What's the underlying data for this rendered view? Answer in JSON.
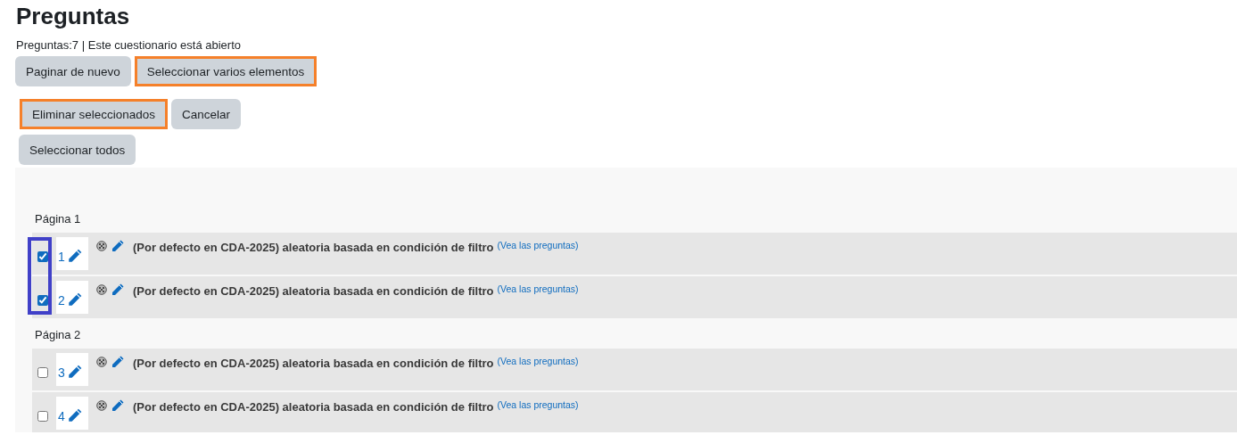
{
  "title": "Preguntas",
  "info": "Preguntas:7 | Este cuestionario está abierto",
  "button_rows": [
    [
      {
        "label": "Paginar de nuevo",
        "highlighted": false
      },
      {
        "label": "Seleccionar varios elementos",
        "highlighted": true
      }
    ],
    [
      {
        "label": "Eliminar seleccionados",
        "highlighted": true
      },
      {
        "label": "Cancelar",
        "highlighted": false
      }
    ],
    [
      {
        "label": "Seleccionar todos",
        "highlighted": false
      }
    ]
  ],
  "pages": [
    {
      "label": "Página 1",
      "checkboxes_outlined": true,
      "slots": [
        {
          "number": "1",
          "checked": true,
          "title": "(Por defecto en CDA-2025) aleatoria basada en condición de filtro",
          "link": "(Vea las preguntas)"
        },
        {
          "number": "2",
          "checked": true,
          "title": "(Por defecto en CDA-2025) aleatoria basada en condición de filtro",
          "link": "(Vea las preguntas)"
        }
      ]
    },
    {
      "label": "Página 2",
      "checkboxes_outlined": false,
      "slots": [
        {
          "number": "3",
          "checked": false,
          "title": "(Por defecto en CDA-2025) aleatoria basada en condición de filtro",
          "link": "(Vea las preguntas)"
        },
        {
          "number": "4",
          "checked": false,
          "title": "(Por defecto en CDA-2025) aleatoria basada en condición de filtro",
          "link": "(Vea las preguntas)"
        }
      ]
    }
  ]
}
